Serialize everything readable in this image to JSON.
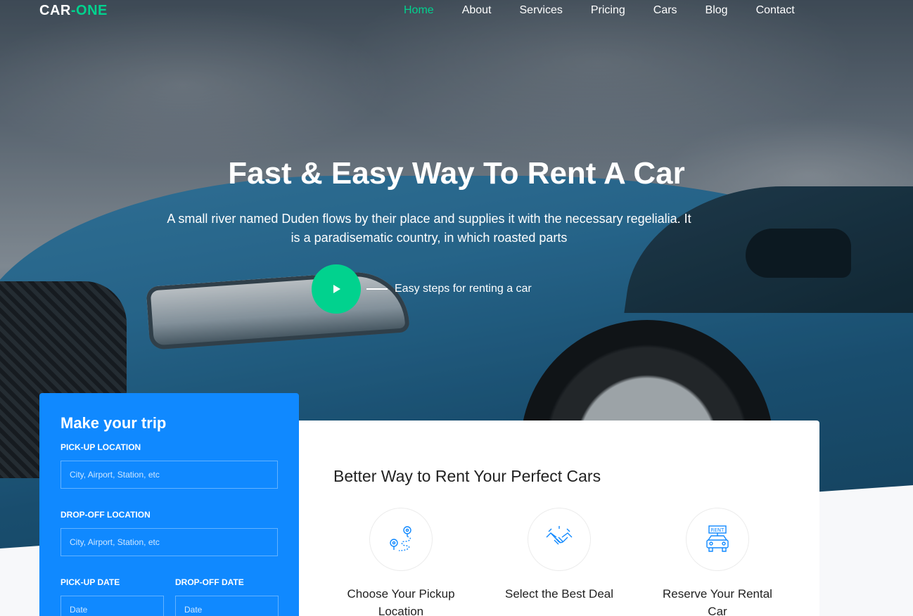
{
  "brand": {
    "name": "CAR",
    "dash": "-",
    "accent": "ONE",
    "accent_color": "#01d28e"
  },
  "nav": {
    "items": [
      {
        "label": "Home",
        "active": true
      },
      {
        "label": "About",
        "active": false
      },
      {
        "label": "Services",
        "active": false
      },
      {
        "label": "Pricing",
        "active": false
      },
      {
        "label": "Cars",
        "active": false
      },
      {
        "label": "Blog",
        "active": false
      },
      {
        "label": "Contact",
        "active": false
      }
    ]
  },
  "hero": {
    "title": "Fast & Easy Way To Rent A Car",
    "subtitle": "A small river named Duden flows by their place and supplies it with the necessary regelialia. It is a paradisematic country, in which roasted parts",
    "play_label": "Easy steps for renting a car",
    "play_icon": "play-icon"
  },
  "trip_form": {
    "heading": "Make your trip",
    "pickup_location_label": "PICK-UP LOCATION",
    "pickup_location_placeholder": "City, Airport, Station, etc",
    "dropoff_location_label": "DROP-OFF LOCATION",
    "dropoff_location_placeholder": "City, Airport, Station, etc",
    "pickup_date_label": "PICK-UP DATE",
    "pickup_date_placeholder": "Date",
    "dropoff_date_label": "DROP-OFF DATE",
    "dropoff_date_placeholder": "Date",
    "background_color": "#1089ff"
  },
  "steps_section": {
    "heading": "Better Way to Rent Your Perfect Cars",
    "steps": [
      {
        "title": "Choose Your Pickup Location",
        "icon": "route-map-icon"
      },
      {
        "title": "Select the Best Deal",
        "icon": "handshake-icon"
      },
      {
        "title": "Reserve Your Rental Car",
        "icon": "rent-car-icon"
      }
    ]
  }
}
